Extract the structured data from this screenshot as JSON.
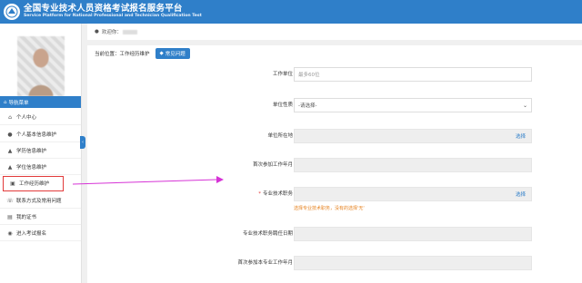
{
  "header": {
    "title": "全国专业技术人员资格考试报名服务平台",
    "subtitle": "Service Platform for National Professional and Technician Qualification Test",
    "logo_icon": "emblem-icon"
  },
  "topbar": {
    "welcome": "欢迎你："
  },
  "sidebar": {
    "nav_title": "导航菜单",
    "items": [
      {
        "label": "个人中心",
        "icon": "home-icon"
      },
      {
        "label": "个人基本信息维护",
        "icon": "user-icon"
      },
      {
        "label": "学历信息维护",
        "icon": "graduation-icon"
      },
      {
        "label": "学位信息维护",
        "icon": "graduation-icon"
      },
      {
        "label": "工作经历维护",
        "icon": "briefcase-icon"
      },
      {
        "label": "联系方式及常用问题",
        "icon": "phone-icon"
      },
      {
        "label": "我的证书",
        "icon": "certificate-icon"
      },
      {
        "label": "进入考试报名",
        "icon": "enter-icon"
      }
    ],
    "active_index": 4
  },
  "breadcrumb": {
    "prefix": "当前位置：",
    "page": "工作经历维护",
    "help_button": "常见问题"
  },
  "form": {
    "fields": [
      {
        "label": "工作单位",
        "placeholder": "最多60位",
        "type": "text",
        "gray": false,
        "required": false
      },
      {
        "label": "单位性质",
        "value": "-请选择-",
        "type": "select",
        "gray": false,
        "required": false
      },
      {
        "label": "单位所在地",
        "action": "选择",
        "type": "picker",
        "gray": true,
        "required": false
      },
      {
        "label": "首次参加工作年月",
        "type": "text",
        "gray": true,
        "required": false
      },
      {
        "label": "专业技术职务",
        "action": "选择",
        "type": "picker",
        "gray": true,
        "required": true
      },
      {
        "label": "专业技术职务聘任日期",
        "type": "text",
        "gray": true,
        "required": false
      },
      {
        "label": "首次参加本专业工作年月",
        "type": "text",
        "gray": true,
        "required": false
      }
    ],
    "hint": "选择专业技术职务，没有的选择'无'",
    "required_mark": "*"
  },
  "colors": {
    "brand": "#2f7fc9",
    "highlight": "#e23a3a",
    "arrow": "#d633d6",
    "hint": "#e6821e"
  }
}
